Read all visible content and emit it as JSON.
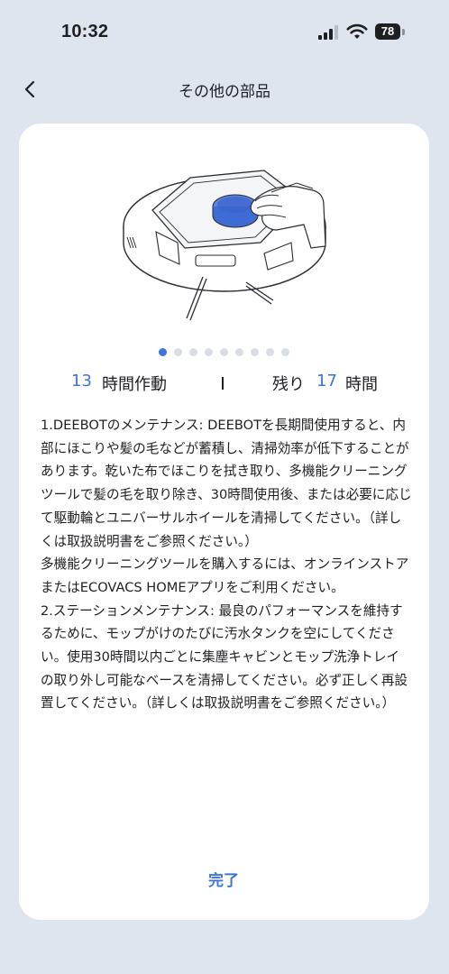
{
  "status_bar": {
    "time": "10:32",
    "battery": "78",
    "icons": [
      "signal-icon",
      "wifi-icon",
      "battery-icon"
    ]
  },
  "nav": {
    "back_icon": "chevron-left-icon",
    "title": "その他の部品"
  },
  "card": {
    "carousel": {
      "page_count": 9,
      "active_index": 0,
      "image_icon": "robot-vacuum-maintenance-illustration"
    },
    "usage": {
      "used_hours": "13",
      "used_label": "時間作動",
      "divider": "|",
      "remaining_label": "残り",
      "remaining_hours": "17",
      "remaining_unit": "時間"
    },
    "description": "1.DEEBOTのメンテナンス: DEEBOTを長期間使用すると、内部にほこりや髪の毛などが蓄積し、清掃効率が低下することがあります。乾いた布でほこりを拭き取り、多機能クリーニングツールで髪の毛を取り除き、30時間使用後、または必要に応じて駆動輪とユニバーサルホイールを清掃してください。（詳しくは取扱説明書をご参照ください。）\n多機能クリーニングツールを購入するには、オンラインストアまたはECOVACS HOMEアプリをご利用ください。\n2.ステーションメンテナンス: 最良のパフォーマンスを維持するために、モップがけのたびに汚水タンクを空にしてください。使用30時間以内ごとに集塵キャビンとモップ洗浄トレイの取り外し可能なベースを清掃してください。必ず正しく再設置してください。（詳しくは取扱説明書をご参照ください。）",
    "done_label": "完了"
  },
  "colors": {
    "accent": "#3f74d8",
    "background": "#dfe5ef",
    "card": "#ffffff",
    "text": "#1e1f22"
  }
}
